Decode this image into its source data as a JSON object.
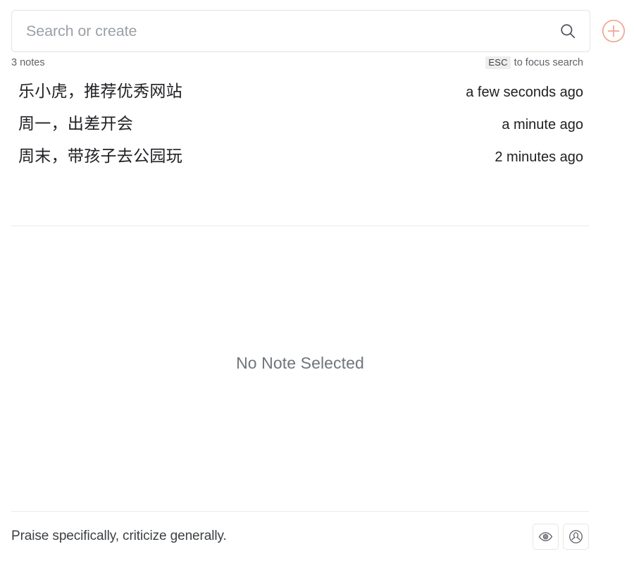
{
  "search": {
    "placeholder": "Search or create",
    "value": "",
    "search_icon": "search-icon",
    "add_icon": "plus-circle-icon",
    "add_icon_color": "#f0a58f"
  },
  "meta": {
    "note_count": "3 notes",
    "esc_key": "ESC",
    "esc_hint_text": "to focus search"
  },
  "notes": [
    {
      "title": "乐小虎，推荐优秀网站",
      "time": "a few seconds ago"
    },
    {
      "title": "周一，出差开会",
      "time": "a minute ago"
    },
    {
      "title": "周末，带孩子去公园玩",
      "time": "2 minutes ago"
    }
  ],
  "content": {
    "empty_state": "No Note Selected"
  },
  "footer": {
    "quote": "Praise specifically, criticize generally.",
    "actions": [
      {
        "name": "eye-icon",
        "label": "Preview"
      },
      {
        "name": "account-icon",
        "label": "Account"
      }
    ]
  },
  "colors": {
    "accent": "#f0a58f",
    "text_primary": "#202124",
    "text_secondary": "#5f6368",
    "text_muted": "#9aa0a6",
    "border": "#e3e3e3",
    "divider": "#eaeaea",
    "background": "#ffffff"
  }
}
